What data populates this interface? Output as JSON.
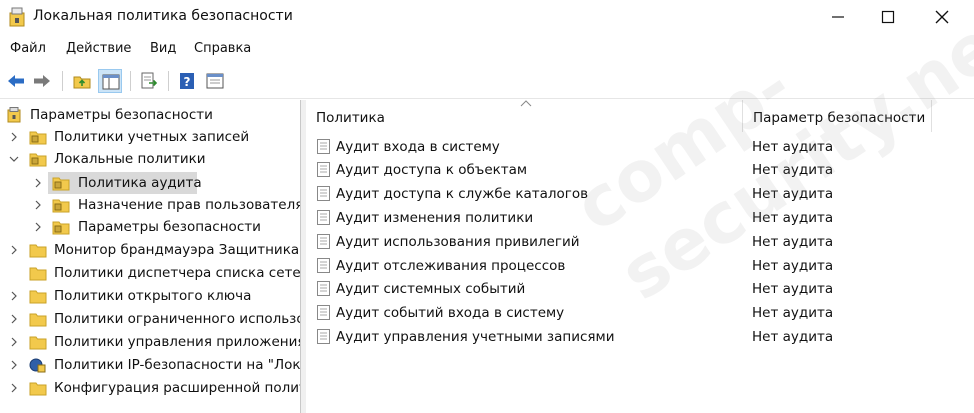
{
  "window": {
    "title": "Локальная политика безопасности"
  },
  "menu": {
    "items": [
      "Файл",
      "Действие",
      "Вид",
      "Справка"
    ]
  },
  "toolbar": {
    "icons": [
      "back-arrow-icon",
      "forward-arrow-icon",
      "up-folder-icon",
      "show-hide-tree-icon",
      "export-list-icon",
      "help-icon",
      "properties-icon"
    ]
  },
  "tree": {
    "items": [
      {
        "label": "Параметры безопасности",
        "icon": "security-settings-icon",
        "expander": "none",
        "level": 0
      },
      {
        "label": "Политики учетных записей",
        "icon": "folder-lock-icon",
        "expander": "collapsed",
        "level": 1
      },
      {
        "label": "Локальные политики",
        "icon": "folder-lock-icon",
        "expander": "expanded",
        "level": 1
      },
      {
        "label": "Политика аудита",
        "icon": "folder-lock-icon",
        "expander": "collapsed",
        "level": 2,
        "selected": true
      },
      {
        "label": "Назначение прав пользователя",
        "icon": "folder-lock-icon",
        "expander": "collapsed",
        "level": 2
      },
      {
        "label": "Параметры безопасности",
        "icon": "folder-lock-icon",
        "expander": "collapsed",
        "level": 2
      },
      {
        "label": "Монитор брандмауэра Защитника Windows",
        "icon": "folder-icon",
        "expander": "collapsed",
        "level": 1
      },
      {
        "label": "Политики диспетчера списка сетей",
        "icon": "folder-icon",
        "expander": "none",
        "level": 1
      },
      {
        "label": "Политики открытого ключа",
        "icon": "folder-icon",
        "expander": "collapsed",
        "level": 1
      },
      {
        "label": "Политики ограниченного использования программ",
        "icon": "folder-icon",
        "expander": "collapsed",
        "level": 1
      },
      {
        "label": "Политики управления приложениями",
        "icon": "folder-icon",
        "expander": "collapsed",
        "level": 1
      },
      {
        "label": "Политики IP-безопасности на \"Локальный компьютер\"",
        "icon": "ip-security-icon",
        "expander": "collapsed",
        "level": 1
      },
      {
        "label": "Конфигурация расширенной политики аудита",
        "icon": "folder-icon",
        "expander": "collapsed",
        "level": 1
      }
    ]
  },
  "list": {
    "columns": [
      "Политика",
      "Параметр безопасности"
    ],
    "rows": [
      {
        "name": "Аудит входа в систему",
        "value": "Нет аудита"
      },
      {
        "name": "Аудит доступа к объектам",
        "value": "Нет аудита"
      },
      {
        "name": "Аудит доступа к службе каталогов",
        "value": "Нет аудита"
      },
      {
        "name": "Аудит изменения политики",
        "value": "Нет аудита"
      },
      {
        "name": "Аудит использования привилегий",
        "value": "Нет аудита"
      },
      {
        "name": "Аудит отслеживания процессов",
        "value": "Нет аудита"
      },
      {
        "name": "Аудит системных событий",
        "value": "Нет аудита"
      },
      {
        "name": "Аудит событий входа в систему",
        "value": "Нет аудита"
      },
      {
        "name": "Аудит управления учетными записями",
        "value": "Нет аудита"
      }
    ]
  },
  "watermark": "comp-security.net",
  "colors": {
    "selection": "#d9d9d9",
    "folder": "#f2c94c",
    "toolbar_blue": "#2b6cc4"
  }
}
